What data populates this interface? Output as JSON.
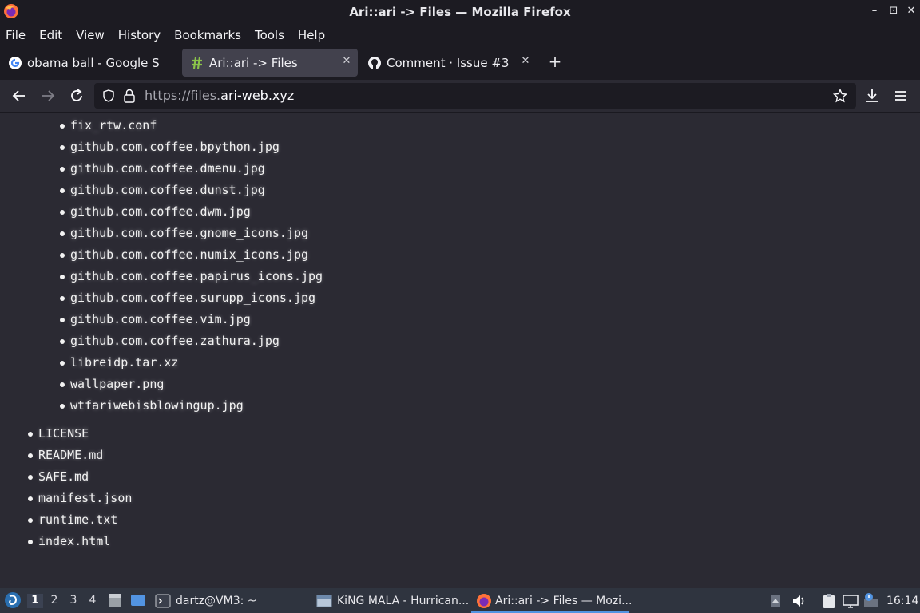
{
  "window": {
    "title": "Ari::ari -> Files — Mozilla Firefox",
    "controls": [
      "–",
      "⊡",
      "✕"
    ]
  },
  "menubar": {
    "items": [
      "File",
      "Edit",
      "View",
      "History",
      "Bookmarks",
      "Tools",
      "Help"
    ]
  },
  "tabs": [
    {
      "label": "obama ball - Google Se",
      "icon": "google-icon"
    },
    {
      "label": "Ari::ari -> Files",
      "icon": "ari-icon",
      "active": true
    },
    {
      "label": "Comment · Issue #3 ·",
      "icon": "github-icon"
    }
  ],
  "navbar": {
    "url_dim": "https://files.",
    "url_host": "ari-web.xyz"
  },
  "files": {
    "nested": [
      "fix_rtw.conf",
      "github.com.coffee.bpython.jpg",
      "github.com.coffee.dmenu.jpg",
      "github.com.coffee.dunst.jpg",
      "github.com.coffee.dwm.jpg",
      "github.com.coffee.gnome_icons.jpg",
      "github.com.coffee.numix_icons.jpg",
      "github.com.coffee.papirus_icons.jpg",
      "github.com.coffee.surupp_icons.jpg",
      "github.com.coffee.vim.jpg",
      "github.com.coffee.zathura.jpg",
      "libreidp.tar.xz",
      "wallpaper.png",
      "wtfariwebisblowingup.jpg"
    ],
    "top": [
      "LICENSE",
      "README.md",
      "SAFE.md",
      "manifest.json",
      "runtime.txt",
      "index.html"
    ]
  },
  "taskbar": {
    "workspaces": [
      "1",
      "2",
      "3",
      "4"
    ],
    "windows": [
      {
        "label": "dartz@VM3: ~",
        "icon": "terminal-icon"
      },
      {
        "label": "KiNG MALA - Hurrican...",
        "icon": "window-icon"
      },
      {
        "label": "Ari::ari -> Files — Mozi...",
        "icon": "firefox-icon"
      }
    ],
    "clock": "16:14"
  }
}
